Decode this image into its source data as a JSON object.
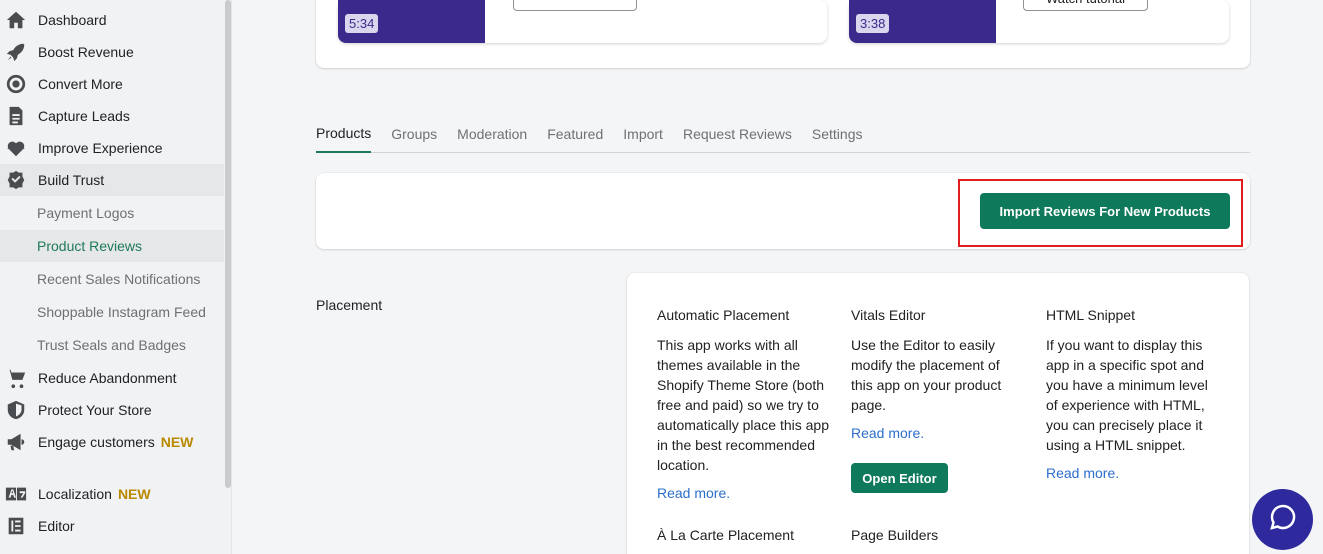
{
  "sidebar": {
    "items": [
      {
        "label": "Dashboard",
        "icon": "home-icon"
      },
      {
        "label": "Boost Revenue",
        "icon": "rocket-icon"
      },
      {
        "label": "Convert More",
        "icon": "target-icon"
      },
      {
        "label": "Capture Leads",
        "icon": "document-icon"
      },
      {
        "label": "Improve Experience",
        "icon": "heartbeat-icon"
      },
      {
        "label": "Build Trust",
        "icon": "verified-badge-icon"
      }
    ],
    "sub_items": [
      {
        "label": "Payment Logos"
      },
      {
        "label": "Product Reviews"
      },
      {
        "label": "Recent Sales Notifications"
      },
      {
        "label": "Shoppable Instagram Feed"
      },
      {
        "label": "Trust Seals and Badges"
      }
    ],
    "lower_items": [
      {
        "label": "Reduce Abandonment",
        "icon": "cart-icon"
      },
      {
        "label": "Protect Your Store",
        "icon": "shield-icon"
      },
      {
        "label": "Engage customers",
        "icon": "megaphone-icon",
        "badge": "NEW"
      },
      {
        "label": "Localization",
        "icon": "translate-icon",
        "badge": "NEW"
      },
      {
        "label": "Editor",
        "icon": "editor-icon"
      }
    ]
  },
  "videos": [
    {
      "duration": "5:34"
    },
    {
      "duration": "3:38",
      "button": "Watch tutorial"
    }
  ],
  "tabs": [
    "Products",
    "Groups",
    "Moderation",
    "Featured",
    "Import",
    "Request Reviews",
    "Settings"
  ],
  "import_button": "Import Reviews For New Products",
  "placement": {
    "label": "Placement",
    "columns": [
      {
        "title": "Automatic Placement",
        "body": "This app works with all themes available in the Shopify Theme Store (both free and paid) so we try to automatically place this app in the best recommended location.",
        "link": "Read more."
      },
      {
        "title": "Vitals Editor",
        "body": "Use the Editor to easily modify the placement of this app on your product page.",
        "link": "Read more.",
        "button": "Open Editor"
      },
      {
        "title": "HTML Snippet",
        "body": "If you want to display this app in a specific spot and you have a minimum level of experience with HTML, you can precisely place it using a HTML snippet.",
        "link": "Read more."
      }
    ],
    "more_titles": [
      "À La Carte Placement",
      "Page Builders"
    ]
  },
  "colors": {
    "accent": "#0f7a5b",
    "link": "#2c6ecb",
    "video": "#3b2a8c",
    "highlight": "#e01e1e"
  }
}
